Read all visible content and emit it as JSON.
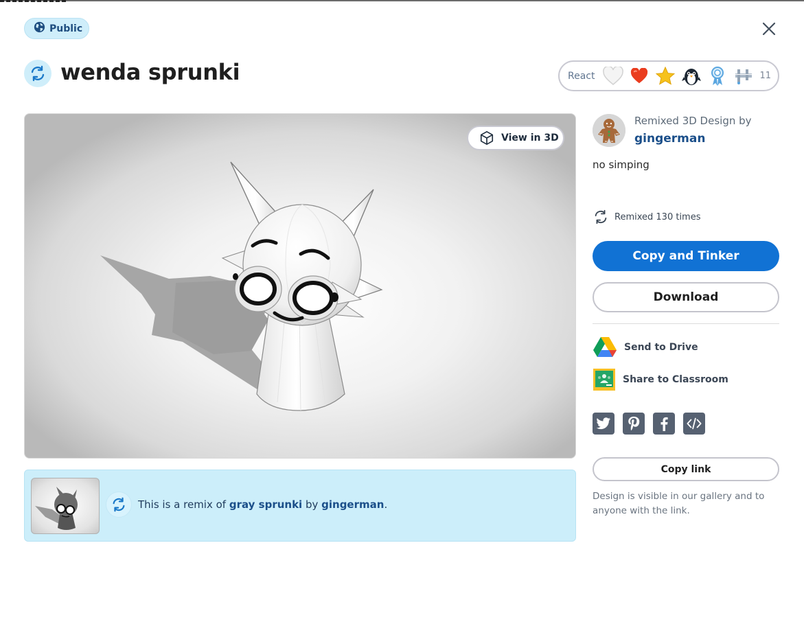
{
  "visibility_badge": {
    "label": "Public"
  },
  "design": {
    "title": "wenda sprunki",
    "description": "no simping"
  },
  "reactions": {
    "label": "React",
    "icons": [
      "heart-outline-icon",
      "heart-icon",
      "star-icon",
      "penguin-icon",
      "ribbon-icon",
      "caliper-icon"
    ],
    "count": "11"
  },
  "viewer": {
    "view3d_label": "View in 3D"
  },
  "remix_banner": {
    "prefix": "This is a remix of ",
    "original_title": "gray sprunki",
    "by_text": " by ",
    "original_author": "gingerman",
    "suffix": "."
  },
  "author": {
    "by_label": "Remixed 3D Design by",
    "name": "gingerman"
  },
  "remix_count": {
    "label": "Remixed 130 times"
  },
  "actions": {
    "primary": "Copy and Tinker",
    "download": "Download",
    "drive": "Send to Drive",
    "classroom": "Share to Classroom",
    "copy_link": "Copy link"
  },
  "social": [
    "twitter-icon",
    "pinterest-icon",
    "facebook-icon",
    "embed-code-icon"
  ],
  "visibility_note": "Design is visible in our gallery and to anyone with the link.",
  "colors": {
    "accent_blue": "#1172d4",
    "link_blue": "#1b4f8a",
    "light_blue_bg": "#cceefa",
    "social_gray": "#566171"
  }
}
